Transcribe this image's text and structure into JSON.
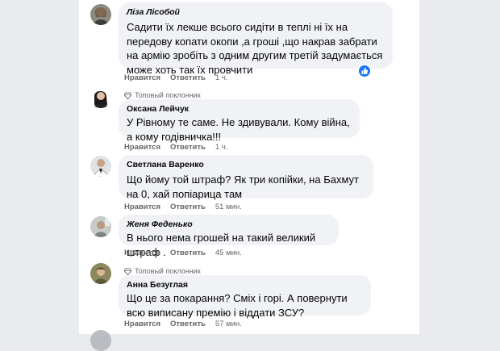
{
  "comments": [
    {
      "author": "Ліза Лісобой",
      "text": "Садити їх лекше всього сидіти в теплі ні їх на передову копати окопи ,а гроші ,що накрав забрати на армію зробіть з одним другим третій задумається може хоть так їх провчити",
      "like_label": "Нравится",
      "reply_label": "Ответить",
      "time": "1 ч."
    },
    {
      "badge": "Топовый поклонник",
      "author": "Оксана Лейчук",
      "text": "У Рівному те саме. Не здивували. Кому війна, а кому годівничка!!!",
      "like_label": "Нравится",
      "reply_label": "Ответить",
      "time": "1 ч."
    },
    {
      "author": "Светлана Варенко",
      "text": "Що йому той штраф? Як три копійки, на Бахмут на 0, хай попіарица там",
      "like_label": "Нравится",
      "reply_label": "Ответить",
      "time": "51 мин."
    },
    {
      "author": "Женя Феденько",
      "text": "В нього нема грошей на такий великий штраф .",
      "like_label": "Нравится",
      "reply_label": "Ответить",
      "time": "45 мин."
    },
    {
      "badge": "Топовый поклонник",
      "author": "Анна Безуглая",
      "text": "Що це за покарання? Сміх і горі. А повернути всю виписану премію і віддати ЗСУ?",
      "like_label": "Нравится",
      "reply_label": "Ответить",
      "time": "57 мин."
    }
  ],
  "icons": {
    "like_reaction": "thumbs-up-icon",
    "top_fan": "diamond-icon"
  },
  "colors": {
    "bubble": "#f0f2f5",
    "like_blue": "#1877f2",
    "meta_gray": "#65676b"
  }
}
